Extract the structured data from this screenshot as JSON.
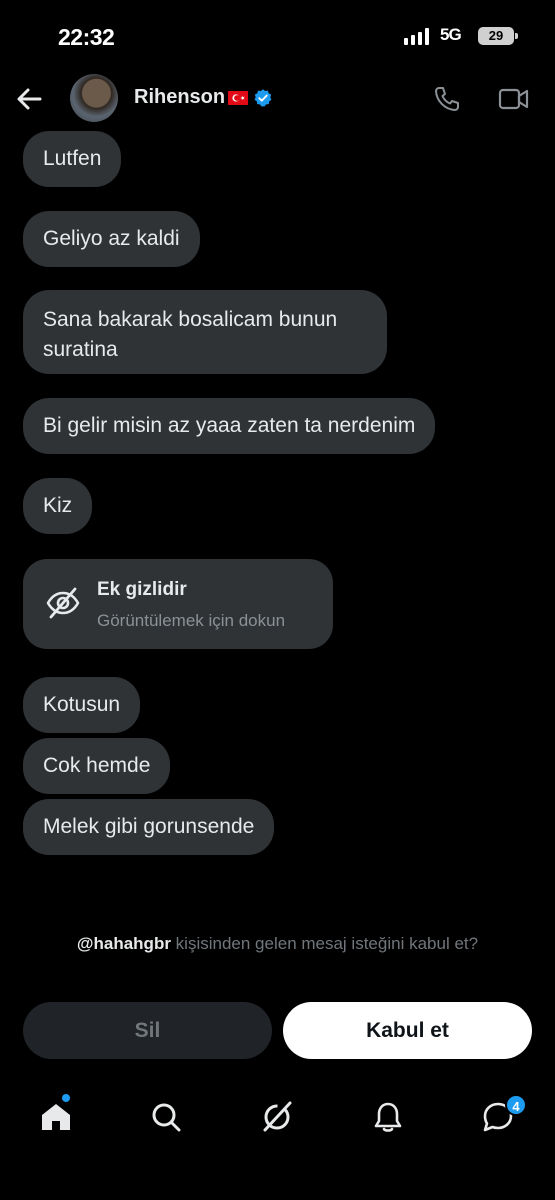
{
  "status_bar": {
    "time": "22:32",
    "network": "5G",
    "battery": "29"
  },
  "header": {
    "contact_name": "Rihenson"
  },
  "messages": [
    {
      "text": "Lutfen"
    },
    {
      "text": "Geliyo az kaldi"
    },
    {
      "text": "Sana bakarak bosalicam bunun suratina"
    },
    {
      "text": "Bi gelir misin az yaaa zaten ta nerdenim"
    },
    {
      "text": "Kiz"
    },
    {
      "text": "Kotusun"
    },
    {
      "text": "Cok hemde"
    },
    {
      "text": "Melek gibi gorunsende"
    }
  ],
  "attachment": {
    "title": "Ek gizlidir",
    "subtitle": "Görüntülemek için dokun"
  },
  "request": {
    "handle": "@hahahgbr",
    "text": " kişisinden gelen mesaj isteğini kabul et?"
  },
  "actions": {
    "delete_label": "Sil",
    "accept_label": "Kabul et"
  },
  "bottom_nav": {
    "messages_badge": "4"
  },
  "colors": {
    "accent": "#1d9bf0",
    "bubble": "#2f3336",
    "background": "#000000"
  }
}
